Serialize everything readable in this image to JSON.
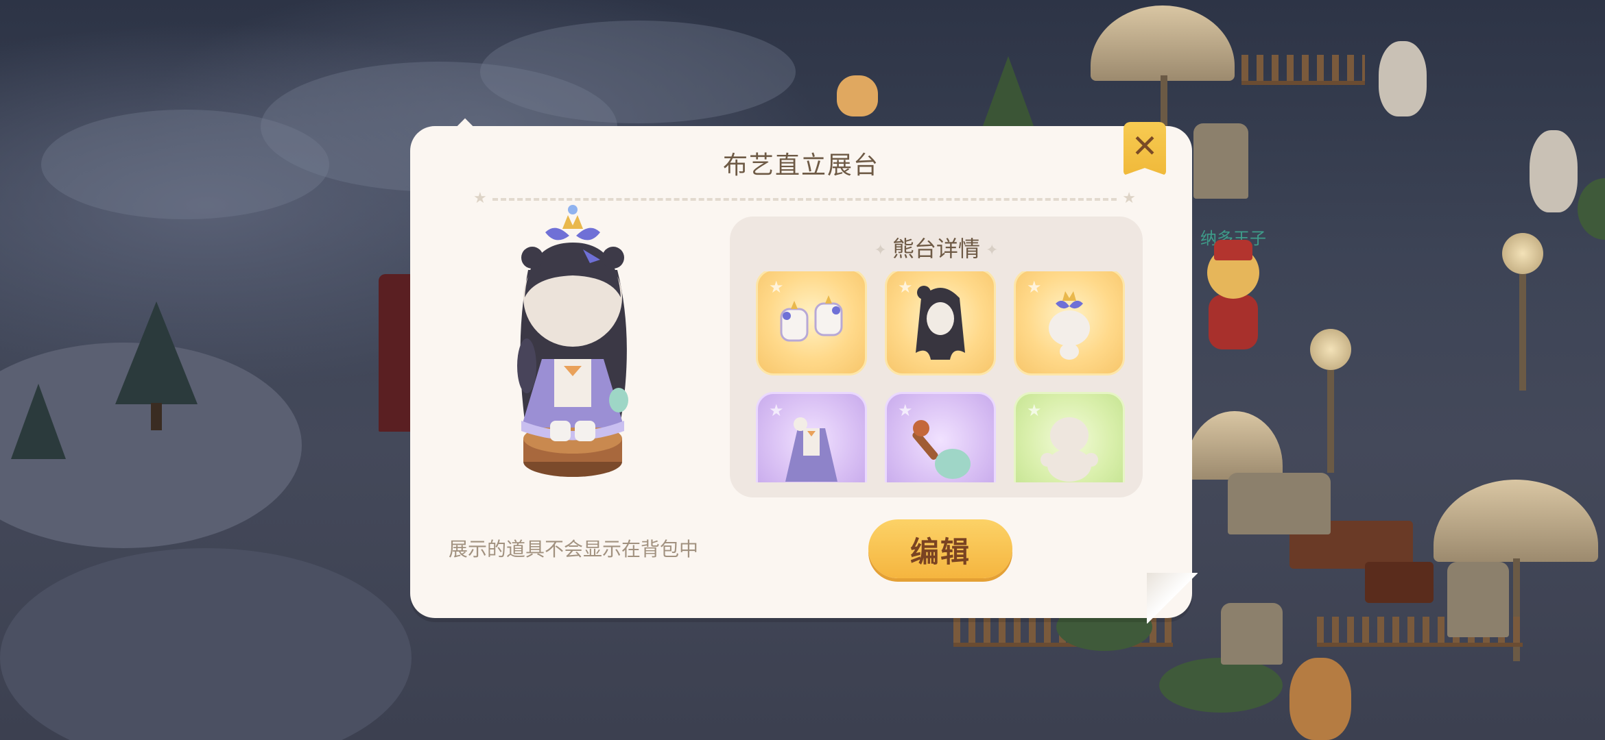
{
  "dialog": {
    "title": "布艺直立展台",
    "close_label": "✕",
    "panel_title": "熊台详情",
    "hint": "展示的道具不会显示在背包中",
    "edit_label": "编辑",
    "items": [
      {
        "name": "boots",
        "rarity": "gold"
      },
      {
        "name": "hair",
        "rarity": "gold"
      },
      {
        "name": "crown-headpiece",
        "rarity": "gold"
      },
      {
        "name": "dress",
        "rarity": "purple"
      },
      {
        "name": "brush-handheld",
        "rarity": "purple"
      },
      {
        "name": "bear-body",
        "rarity": "green"
      }
    ]
  },
  "scene": {
    "player_name": "纳多王子"
  },
  "colors": {
    "dialog_bg": "#fbf6f1",
    "panel_bg": "#efe7e1",
    "title_text": "#6e5a45",
    "hint_text": "#a1917f",
    "button_gold": "#f5b53f"
  }
}
